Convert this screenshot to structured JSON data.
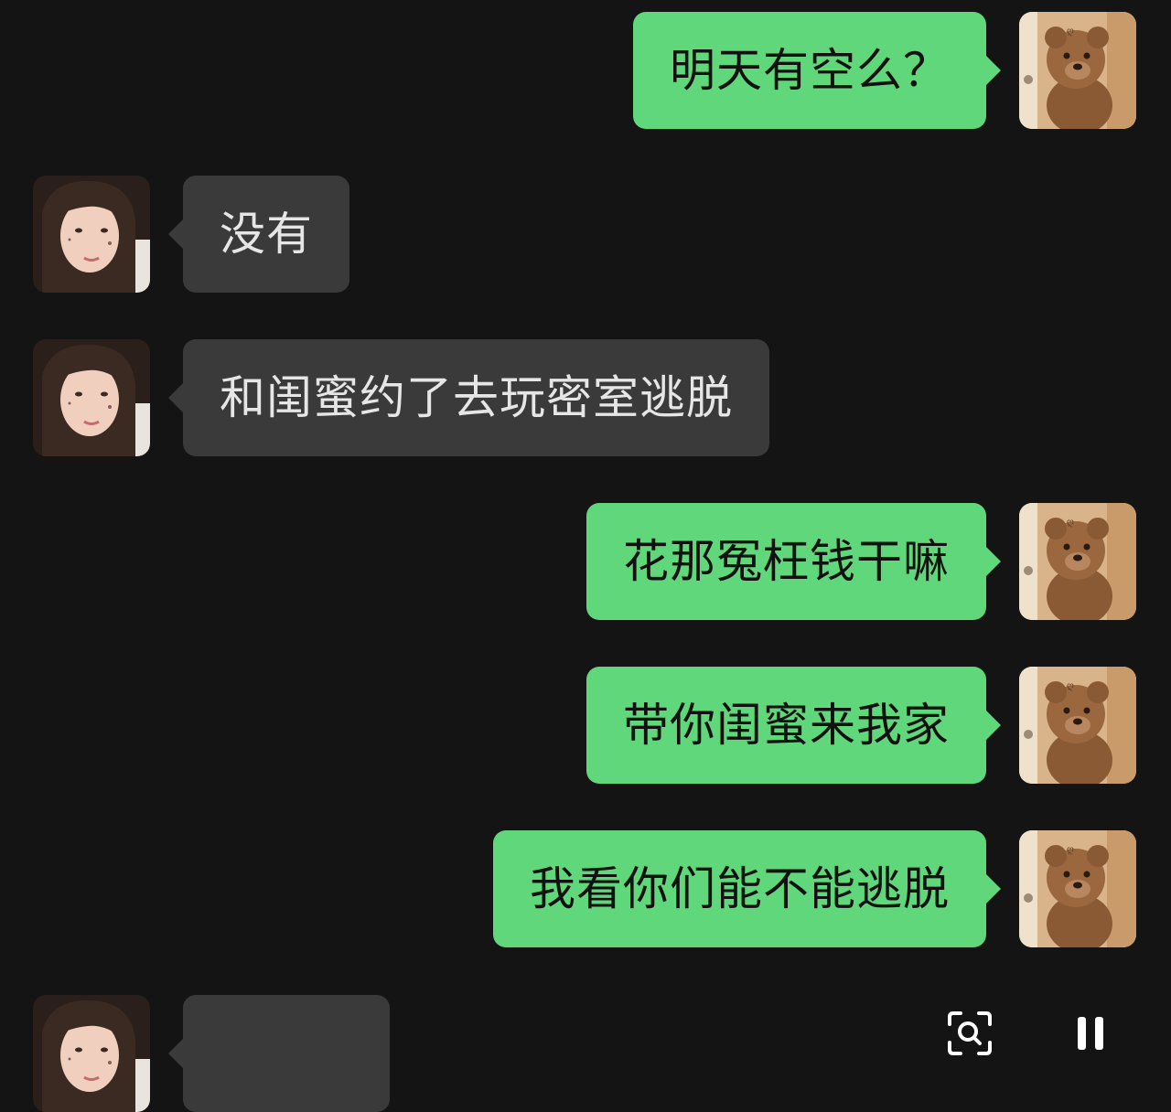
{
  "messages": [
    {
      "side": "sent",
      "text": "明天有空么？"
    },
    {
      "side": "recv",
      "text": "没有"
    },
    {
      "side": "recv",
      "text": "和闺蜜约了去玩密室逃脱"
    },
    {
      "side": "sent",
      "text": "花那冤枉钱干嘛"
    },
    {
      "side": "sent",
      "text": "带你闺蜜来我家"
    },
    {
      "side": "sent",
      "text": "我看你们能不能逃脱"
    },
    {
      "side": "recv",
      "text": ""
    }
  ],
  "colors": {
    "background": "#141414",
    "sent_bubble": "#5fd77a",
    "recv_bubble": "#3a3a3a"
  },
  "icons": {
    "sent_avatar": "teddy-bear-avatar",
    "recv_avatar": "girl-avatar",
    "lens": "visual-search-icon",
    "pause": "pause-icon"
  }
}
